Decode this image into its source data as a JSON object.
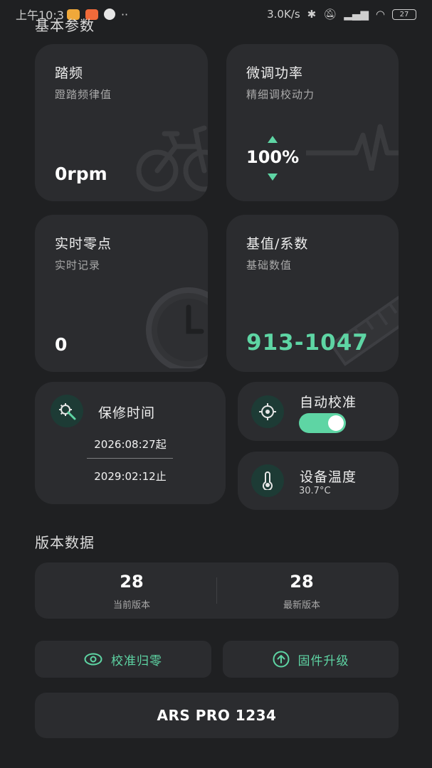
{
  "status_bar": {
    "time": "上午10:3",
    "network_speed": "3.0K/s",
    "battery": "27"
  },
  "basic_params": {
    "title": "基本参数",
    "cadence": {
      "title": "踏频",
      "subtitle": "蹬踏频律值",
      "value": "0rpm"
    },
    "fine_tune": {
      "title": "微调功率",
      "subtitle": "精细调校动力",
      "value": "100%"
    },
    "zero_point": {
      "title": "实时零点",
      "subtitle": "实时记录",
      "value": "0"
    },
    "base_coef": {
      "title": "基值/系数",
      "subtitle": "基础数值",
      "value": "913-1047"
    }
  },
  "warranty": {
    "title": "保修时间",
    "start": "2026:08:27起",
    "end": "2029:02:12止"
  },
  "auto_calibration": {
    "title": "自动校准",
    "enabled": true
  },
  "device_temp": {
    "title": "设备温度",
    "value": "30.7°C"
  },
  "version": {
    "title": "版本数据",
    "current_value": "28",
    "current_label": "当前版本",
    "latest_value": "28",
    "latest_label": "最新版本"
  },
  "actions": {
    "calibrate_zero": "校准归零",
    "firmware_upgrade": "固件升级"
  },
  "device_name": "ARS PRO 1234",
  "colors": {
    "accent": "#5ed5a4",
    "card": "#2b2c2f",
    "background": "#1f2022"
  }
}
